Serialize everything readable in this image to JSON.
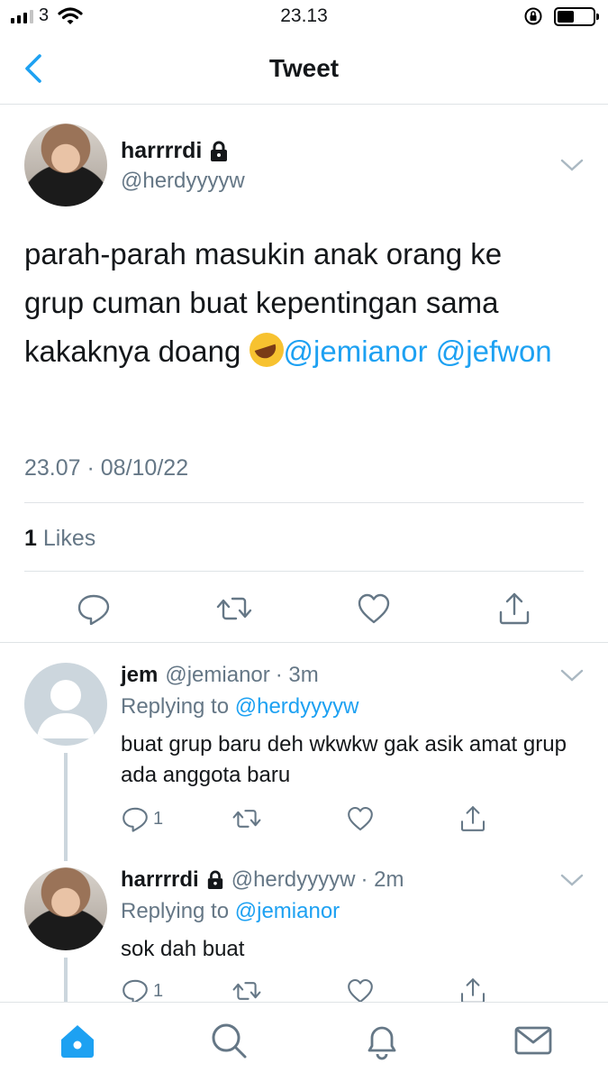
{
  "status_bar": {
    "carrier": "3",
    "time": "23.13"
  },
  "nav": {
    "title": "Tweet"
  },
  "main_tweet": {
    "display_name": "harrrrdi",
    "handle": "@herdyyyyw",
    "text_plain": "parah-parah masukin anak orang ke grup cuman buat kepentingan sama kakaknya doang",
    "mention_1": "@jemianor",
    "mention_2": "@jefwon",
    "timestamp": "23.07 · 08/10/22",
    "likes_count": "1",
    "likes_label": "Likes"
  },
  "replies": [
    {
      "display_name": "jem",
      "handle": "@jemianor",
      "time": "· 3m",
      "replying_prefix": "Replying to",
      "replying_to": "@herdyyyyw",
      "text": "buat grup baru deh wkwkw gak asik amat grup ada anggota baru",
      "reply_count": "1"
    },
    {
      "display_name": "harrrrdi",
      "handle": "@herdyyyyw",
      "time": "· 2m",
      "replying_prefix": "Replying to",
      "replying_to": "@jemianor",
      "text": "sok dah buat",
      "reply_count": "1"
    }
  ],
  "icons": {
    "back": "chevron-left-icon",
    "lock": "lock-icon",
    "more": "chevron-down-icon",
    "reply": "reply-icon",
    "retweet": "retweet-icon",
    "like": "heart-icon",
    "share": "share-icon",
    "home": "home-icon",
    "search": "search-icon",
    "notifications": "bell-icon",
    "messages": "mail-icon"
  },
  "colors": {
    "accent": "#1da1f2",
    "muted": "#657786",
    "text": "#14171a",
    "divider": "#dfe3e6"
  }
}
